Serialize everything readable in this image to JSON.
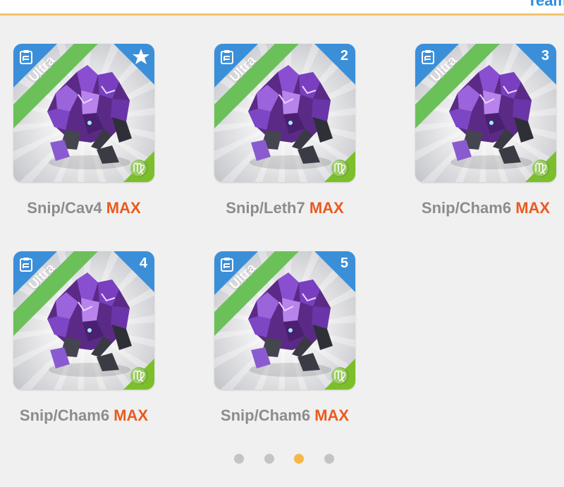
{
  "header": {
    "team_link": "Team"
  },
  "cards": [
    {
      "name": "Snip/Cav4",
      "level": "MAX",
      "rarity": "Ultra",
      "badge": "star",
      "zodiac": "♍"
    },
    {
      "name": "Snip/Leth7",
      "level": "MAX",
      "rarity": "Ultra",
      "badge": "2",
      "zodiac": "♍"
    },
    {
      "name": "Snip/Cham6",
      "level": "MAX",
      "rarity": "Ultra",
      "badge": "3",
      "zodiac": "♍"
    },
    {
      "name": "Snip/Cham6",
      "level": "MAX",
      "rarity": "Ultra",
      "badge": "4",
      "zodiac": "♍"
    },
    {
      "name": "Snip/Cham6",
      "level": "MAX",
      "rarity": "Ultra",
      "badge": "5",
      "zodiac": "♍"
    }
  ],
  "pagination": {
    "total": 4,
    "active_index": 2
  },
  "icons": {
    "corner": "notes-icon",
    "favorite": "star-icon",
    "zodiac": "virgo-icon",
    "creature": "crystal-monster-icon"
  },
  "colors": {
    "ultra_banner": "#6cc05a",
    "corner_blue": "#3b8fd9",
    "zodiac_green": "#7cbf2a",
    "max_text": "#ea5a1e",
    "caption_text": "#8c8c8c",
    "dot_active": "#f5b74a",
    "dot_inactive": "#c4c4c4",
    "header_border": "#f2c36b"
  }
}
